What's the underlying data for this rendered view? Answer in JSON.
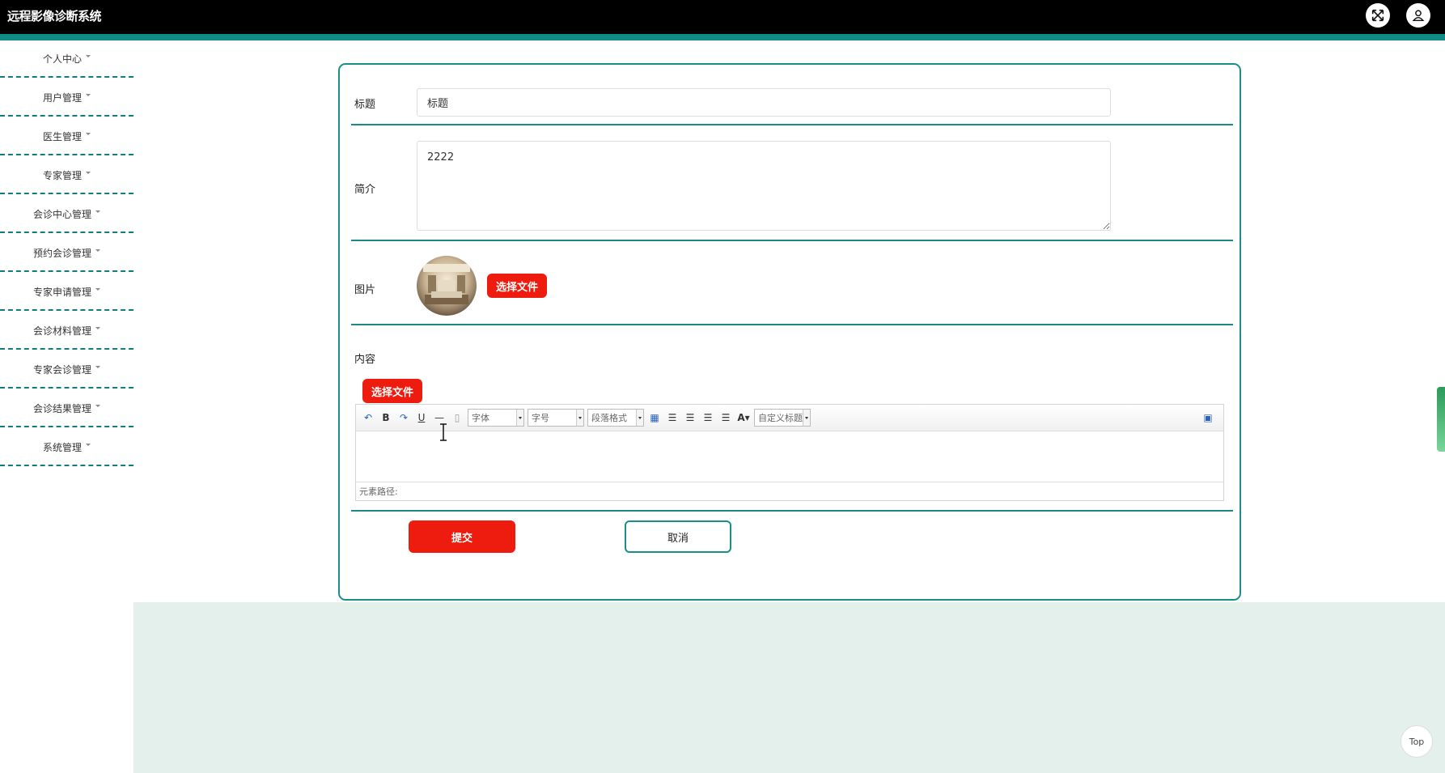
{
  "app": {
    "title": "远程影像诊断系统"
  },
  "sidebar": {
    "items": [
      {
        "label": "个人中心"
      },
      {
        "label": "用户管理"
      },
      {
        "label": "医生管理"
      },
      {
        "label": "专家管理"
      },
      {
        "label": "会诊中心管理"
      },
      {
        "label": "预约会诊管理"
      },
      {
        "label": "专家申请管理"
      },
      {
        "label": "会诊材料管理"
      },
      {
        "label": "专家会诊管理"
      },
      {
        "label": "会诊结果管理"
      },
      {
        "label": "系统管理"
      }
    ]
  },
  "form": {
    "title_label": "标题",
    "title_value": "标题",
    "intro_label": "简介",
    "intro_value": "2222",
    "image_label": "图片",
    "image_button": "选择文件",
    "content_label": "内容",
    "content_file_button": "选择文件",
    "editor": {
      "font_select": "字体",
      "size_select": "字号",
      "format_select": "段落格式",
      "custom_select": "自定义标题",
      "path_label": "元素路径:"
    },
    "submit_label": "提交",
    "cancel_label": "取消"
  },
  "top_button": "Top",
  "colors": {
    "accent": "#0f8a86",
    "danger": "#ee1c0e",
    "footer_bg": "#e4f0ec"
  }
}
